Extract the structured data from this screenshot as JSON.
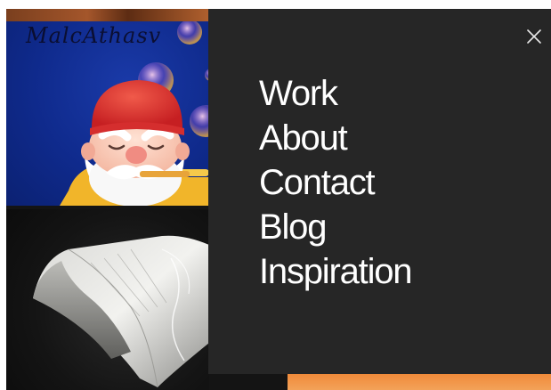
{
  "menu": {
    "items": [
      {
        "label": "Work"
      },
      {
        "label": "About"
      },
      {
        "label": "Contact"
      },
      {
        "label": "Blog"
      },
      {
        "label": "Inspiration"
      }
    ]
  },
  "thumbnails": {
    "gnome": {
      "signature": "MalcAthasv"
    }
  },
  "icons": {
    "close": "close-icon"
  },
  "colors": {
    "menu_background": "#262626",
    "menu_text": "#ffffff",
    "gnome_background": "#0f2a8c",
    "accent_orange": "#f08a3a"
  }
}
